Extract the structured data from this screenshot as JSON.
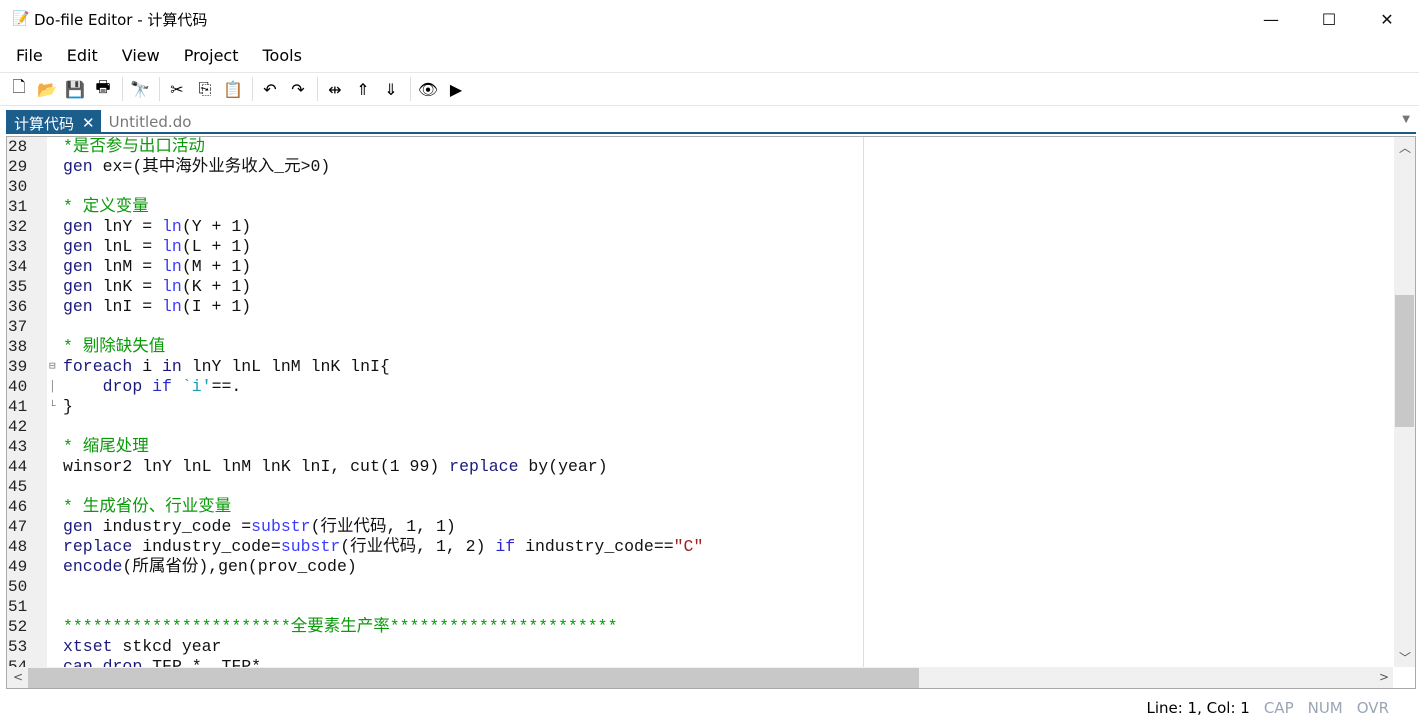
{
  "window": {
    "title": "Do-file Editor - 计算代码",
    "minimize": "—",
    "maximize": "☐",
    "close": "✕"
  },
  "menu": [
    "File",
    "Edit",
    "View",
    "Project",
    "Tools"
  ],
  "toolbar": [
    {
      "name": "new-file-icon",
      "glyph": "🗋"
    },
    {
      "name": "open-icon",
      "glyph": "📂"
    },
    {
      "name": "save-icon",
      "glyph": "💾"
    },
    {
      "name": "print-icon",
      "glyph": "🖶"
    },
    "sep",
    {
      "name": "find-icon",
      "glyph": "🔭"
    },
    "sep",
    {
      "name": "cut-icon",
      "glyph": "✂"
    },
    {
      "name": "copy-icon",
      "glyph": "⎘"
    },
    {
      "name": "paste-icon",
      "glyph": "📋"
    },
    "sep",
    {
      "name": "undo-icon",
      "glyph": "↶"
    },
    {
      "name": "redo-icon",
      "glyph": "↷"
    },
    "sep",
    {
      "name": "toggle-bookmark-icon",
      "glyph": "⇹"
    },
    {
      "name": "previous-bookmark-icon",
      "glyph": "⇑"
    },
    {
      "name": "next-bookmark-icon",
      "glyph": "⇓"
    },
    "sep",
    {
      "name": "show-data-icon",
      "glyph": "👁"
    },
    {
      "name": "execute-icon",
      "glyph": "▶"
    }
  ],
  "tabs": [
    {
      "label": "计算代码",
      "close": "✕"
    },
    {
      "label": "Untitled.do"
    }
  ],
  "code": [
    {
      "n": "28",
      "t": [
        [
          "cmt",
          "*是否参与出口活动"
        ]
      ]
    },
    {
      "n": "29",
      "t": [
        [
          "cmd",
          "gen"
        ],
        [
          "plain",
          " ex=(其中海外业务收入_元>0)"
        ]
      ]
    },
    {
      "n": "30",
      "t": []
    },
    {
      "n": "31",
      "t": [
        [
          "cmt",
          "* 定义变量"
        ]
      ]
    },
    {
      "n": "32",
      "t": [
        [
          "cmd",
          "gen"
        ],
        [
          "plain",
          " lnY = "
        ],
        [
          "fn",
          "ln"
        ],
        [
          "plain",
          "(Y + 1)"
        ]
      ]
    },
    {
      "n": "33",
      "t": [
        [
          "cmd",
          "gen"
        ],
        [
          "plain",
          " lnL = "
        ],
        [
          "fn",
          "ln"
        ],
        [
          "plain",
          "(L + 1)"
        ]
      ]
    },
    {
      "n": "34",
      "t": [
        [
          "cmd",
          "gen"
        ],
        [
          "plain",
          " lnM = "
        ],
        [
          "fn",
          "ln"
        ],
        [
          "plain",
          "(M + 1)"
        ]
      ]
    },
    {
      "n": "35",
      "t": [
        [
          "cmd",
          "gen"
        ],
        [
          "plain",
          " lnK = "
        ],
        [
          "fn",
          "ln"
        ],
        [
          "plain",
          "(K + 1)"
        ]
      ]
    },
    {
      "n": "36",
      "t": [
        [
          "cmd",
          "gen"
        ],
        [
          "plain",
          " lnI = "
        ],
        [
          "fn",
          "ln"
        ],
        [
          "plain",
          "(I + 1)"
        ]
      ]
    },
    {
      "n": "37",
      "t": []
    },
    {
      "n": "38",
      "t": [
        [
          "cmt",
          "* 剔除缺失值"
        ]
      ]
    },
    {
      "n": "39",
      "t": [
        [
          "cmd",
          "foreach"
        ],
        [
          "plain",
          " i "
        ],
        [
          "cmd",
          "in"
        ],
        [
          "plain",
          " lnY lnL lnM lnK lnI{"
        ]
      ],
      "fold": "⊟"
    },
    {
      "n": "40",
      "t": [
        [
          "plain",
          "    "
        ],
        [
          "cmd",
          "drop"
        ],
        [
          "plain",
          " "
        ],
        [
          "kw",
          "if"
        ],
        [
          "plain",
          " "
        ],
        [
          "macro",
          "`i'"
        ],
        [
          "plain",
          "==."
        ]
      ],
      "fold": "│"
    },
    {
      "n": "41",
      "t": [
        [
          "plain",
          "}"
        ]
      ],
      "fold": "└"
    },
    {
      "n": "42",
      "t": []
    },
    {
      "n": "43",
      "t": [
        [
          "cmt",
          "* 缩尾处理"
        ]
      ]
    },
    {
      "n": "44",
      "t": [
        [
          "plain",
          "winsor2 lnY lnL lnM lnK lnI, cut(1 99) "
        ],
        [
          "cmd",
          "replace"
        ],
        [
          "plain",
          " by(year)"
        ]
      ]
    },
    {
      "n": "45",
      "t": []
    },
    {
      "n": "46",
      "t": [
        [
          "cmt",
          "* 生成省份、行业变量"
        ]
      ]
    },
    {
      "n": "47",
      "t": [
        [
          "cmd",
          "gen"
        ],
        [
          "plain",
          " industry_code ="
        ],
        [
          "fn",
          "substr"
        ],
        [
          "plain",
          "(行业代码, 1, 1)"
        ]
      ]
    },
    {
      "n": "48",
      "t": [
        [
          "cmd",
          "replace"
        ],
        [
          "plain",
          " industry_code="
        ],
        [
          "fn",
          "substr"
        ],
        [
          "plain",
          "(行业代码, 1, 2) "
        ],
        [
          "kw",
          "if"
        ],
        [
          "plain",
          " industry_code=="
        ],
        [
          "str",
          "\"C\""
        ]
      ]
    },
    {
      "n": "49",
      "t": [
        [
          "cmd",
          "encode"
        ],
        [
          "plain",
          "(所属省份),gen(prov_code)"
        ]
      ]
    },
    {
      "n": "50",
      "t": []
    },
    {
      "n": "51",
      "t": []
    },
    {
      "n": "52",
      "t": [
        [
          "cmt",
          "***********************全要素生产率***********************"
        ]
      ]
    },
    {
      "n": "53",
      "t": [
        [
          "cmd",
          "xtset"
        ],
        [
          "plain",
          " stkcd year"
        ]
      ]
    },
    {
      "n": "54",
      "t": [
        [
          "cmd",
          "cap"
        ],
        [
          "plain",
          " "
        ],
        [
          "cmd",
          "drop"
        ],
        [
          "plain",
          " TFP_* _TFP*"
        ]
      ]
    }
  ],
  "status": {
    "position": "Line: 1, Col: 1",
    "cap": "CAP",
    "num": "NUM",
    "ovr": "OVR"
  }
}
